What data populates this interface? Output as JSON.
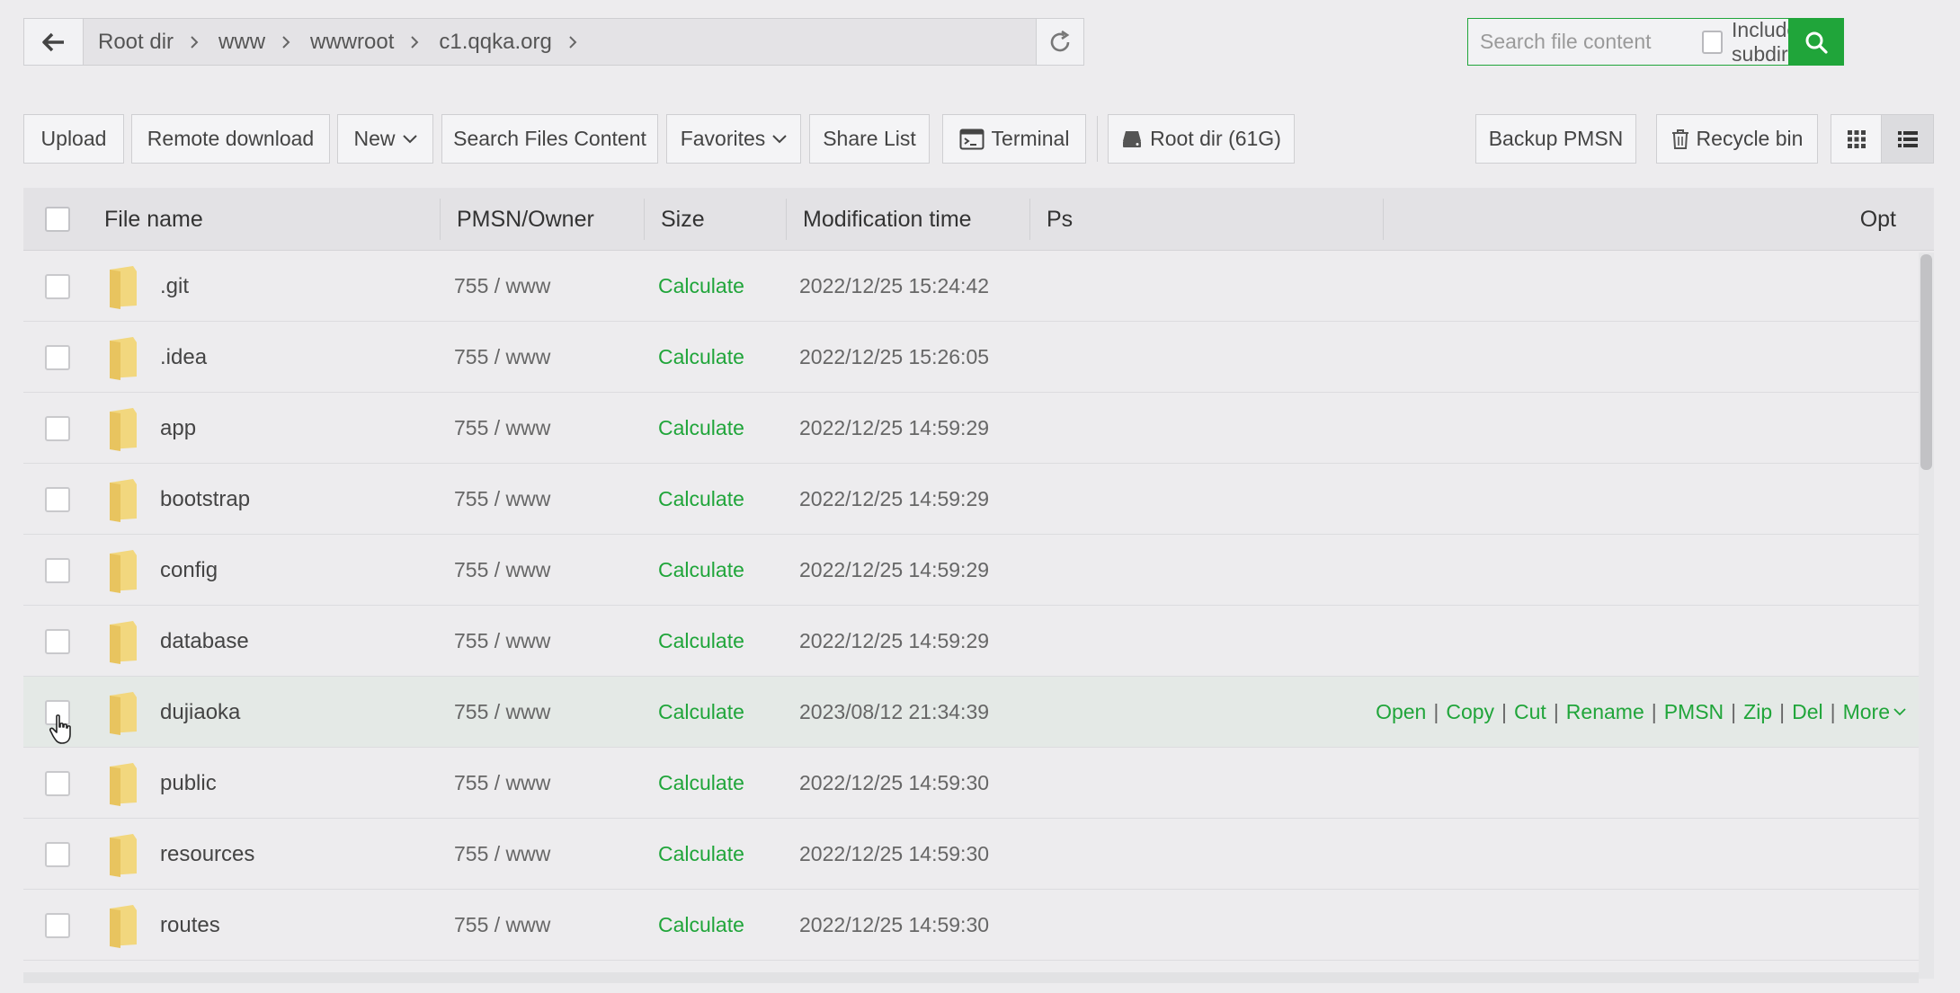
{
  "breadcrumb": {
    "items": [
      "Root dir",
      "www",
      "wwwroot",
      "c1.qqka.org"
    ]
  },
  "search": {
    "placeholder": "Search file content",
    "include_subdir_label": "Include subdir"
  },
  "toolbar": {
    "upload": "Upload",
    "remote_download": "Remote download",
    "new": "New",
    "search_files_content": "Search Files Content",
    "favorites": "Favorites",
    "share_list": "Share List",
    "terminal": "Terminal",
    "root_dir": "Root dir (61G)",
    "backup_pmsn": "Backup PMSN",
    "recycle_bin": "Recycle bin"
  },
  "table": {
    "headers": {
      "file_name": "File name",
      "pmsn_owner": "PMSN/Owner",
      "size": "Size",
      "modification_time": "Modification time",
      "ps": "Ps",
      "opt": "Opt"
    },
    "rows": [
      {
        "name": ".git",
        "perm": "755 / www",
        "size": "Calculate",
        "mtime": "2022/12/25 15:24:42"
      },
      {
        "name": ".idea",
        "perm": "755 / www",
        "size": "Calculate",
        "mtime": "2022/12/25 15:26:05"
      },
      {
        "name": "app",
        "perm": "755 / www",
        "size": "Calculate",
        "mtime": "2022/12/25 14:59:29"
      },
      {
        "name": "bootstrap",
        "perm": "755 / www",
        "size": "Calculate",
        "mtime": "2022/12/25 14:59:29"
      },
      {
        "name": "config",
        "perm": "755 / www",
        "size": "Calculate",
        "mtime": "2022/12/25 14:59:29"
      },
      {
        "name": "database",
        "perm": "755 / www",
        "size": "Calculate",
        "mtime": "2022/12/25 14:59:29"
      },
      {
        "name": "dujiaoka",
        "perm": "755 / www",
        "size": "Calculate",
        "mtime": "2023/08/12 21:34:39"
      },
      {
        "name": "public",
        "perm": "755 / www",
        "size": "Calculate",
        "mtime": "2022/12/25 14:59:30"
      },
      {
        "name": "resources",
        "perm": "755 / www",
        "size": "Calculate",
        "mtime": "2022/12/25 14:59:30"
      },
      {
        "name": "routes",
        "perm": "755 / www",
        "size": "Calculate",
        "mtime": "2022/12/25 14:59:30"
      }
    ],
    "row_ops": {
      "open": "Open",
      "copy": "Copy",
      "cut": "Cut",
      "rename": "Rename",
      "pmsn": "PMSN",
      "zip": "Zip",
      "del": "Del",
      "more": "More",
      "separator": "|"
    }
  },
  "colors": {
    "accent": "#20a53a",
    "folder": "#f2d77e",
    "background": "#edecee"
  }
}
